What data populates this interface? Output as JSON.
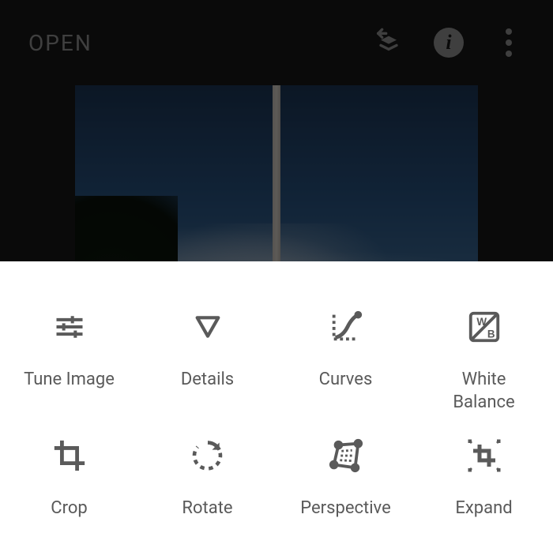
{
  "topbar": {
    "open_label": "OPEN"
  },
  "tools": {
    "tune": "Tune Image",
    "details": "Details",
    "curves": "Curves",
    "white_balance": "White\nBalance",
    "crop": "Crop",
    "rotate": "Rotate",
    "perspective": "Perspective",
    "expand": "Expand"
  }
}
